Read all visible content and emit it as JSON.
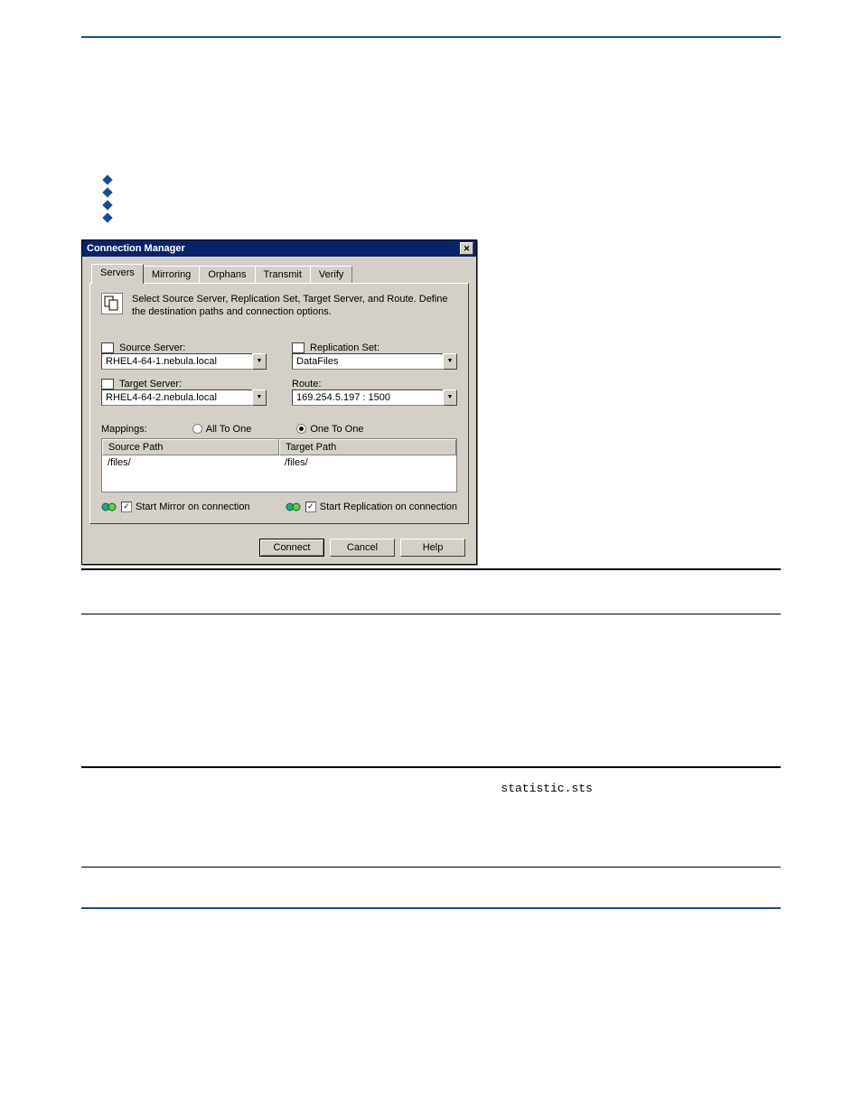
{
  "dialog": {
    "title": "Connection Manager",
    "tabs": [
      "Servers",
      "Mirroring",
      "Orphans",
      "Transmit",
      "Verify"
    ],
    "description": "Select Source Server, Replication Set, Target Server, and Route.  Define the destination paths and connection options.",
    "source_label": "Source Server:",
    "source_value": "RHEL4-64-1.nebula.local",
    "repset_label": "Replication Set:",
    "repset_value": "DataFiles",
    "target_label": "Target Server:",
    "target_value": "RHEL4-64-2.nebula.local",
    "route_label": "Route:",
    "route_value": "169.254.5.197 : 1500",
    "mappings_label": "Mappings:",
    "radio_all": "All To One",
    "radio_one": "One To One",
    "col_source": "Source Path",
    "col_target": "Target Path",
    "row_source": "/files/",
    "row_target": "/files/",
    "chk_mirror": "Start Mirror on connection",
    "chk_repl": "Start Replication on connection",
    "btn_connect": "Connect",
    "btn_cancel": "Cancel",
    "btn_help": "Help"
  },
  "mono_text": "statistic.sts"
}
